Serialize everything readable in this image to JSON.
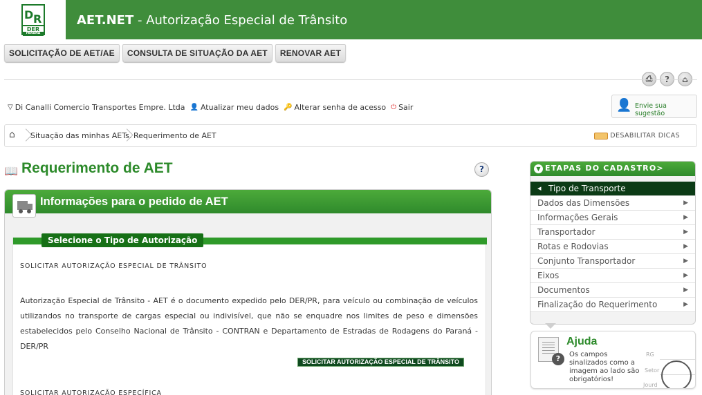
{
  "header": {
    "logo": {
      "line1": "DER",
      "line2": "PARANÁ"
    },
    "app_name": "AET.NET",
    "subtitle": " - Autorização Especial de Trânsito"
  },
  "top_menu": [
    {
      "label": "SOLICITAÇÃO DE AET/AE"
    },
    {
      "label": "CONSULTA DE SITUAÇÃO DA AET"
    },
    {
      "label": "RENOVAR AET"
    }
  ],
  "tool_icons": [
    "print-icon",
    "help-icon",
    "home-icon"
  ],
  "user_bar": {
    "company": "Di Canalli Comercio Transportes Empre. Ltda",
    "update_data": "Atualizar meu dados",
    "change_password": "Alterar senha de acesso",
    "logout": "Sair"
  },
  "suggestion": {
    "label": "Envie sua sugestão"
  },
  "breadcrumb": {
    "items": [
      "Situação das minhas AETs.",
      "Requerimento de AET"
    ],
    "tips_label": "DESABILITAR DICAS"
  },
  "page": {
    "title": "Requerimento de AET"
  },
  "panel": {
    "title": "Informações para o pedido de AET",
    "section_tab": "Selecione o Tipo de Autorização",
    "heading1": "SOLICITAR AUTORIZAÇÃO ESPECIAL DE TRÂNSITO",
    "paragraph": "Autorização Especial de Trânsito - AET é o documento expedido pelo DER/PR, para veículo ou combinação de veículos utilizandos no transporte de cargas especial ou indivisível, que não se enquadre nos limites de peso e dimensões estabelecidos pelo Conselho Nacional de Trânsito - CONTRAN e Departamento de Estradas de Rodagens do Paraná - DER/PR",
    "button": "SOLICITAR AUTORIZAÇÃO ESPECIAL DE TRÂNSITO",
    "heading2": "SOLICITAR AUTORIZAÇÃO ESPECÍFICA"
  },
  "steps": {
    "title": "ETAPAS DO CADASTRO>",
    "items": [
      {
        "label": "Tipo de Transporte"
      },
      {
        "label": "Dados das Dimensões"
      },
      {
        "label": "Informações Gerais"
      },
      {
        "label": "Transportador"
      },
      {
        "label": "Rotas e Rodovias"
      },
      {
        "label": "Conjunto Transportador"
      },
      {
        "label": "Eixos"
      },
      {
        "label": "Documentos"
      },
      {
        "label": "Finalização do Requerimento"
      }
    ]
  },
  "help": {
    "title": "Ajuda",
    "text": "Os campos sinalizados como a imagem ao lado são obrigatórios!",
    "mock_labels": [
      "RG",
      "Setor",
      "Jourd"
    ]
  },
  "colors": {
    "brand_green": "#3f8d3b",
    "active_step": "#0c3b16",
    "title_green": "#2c8a2a"
  }
}
